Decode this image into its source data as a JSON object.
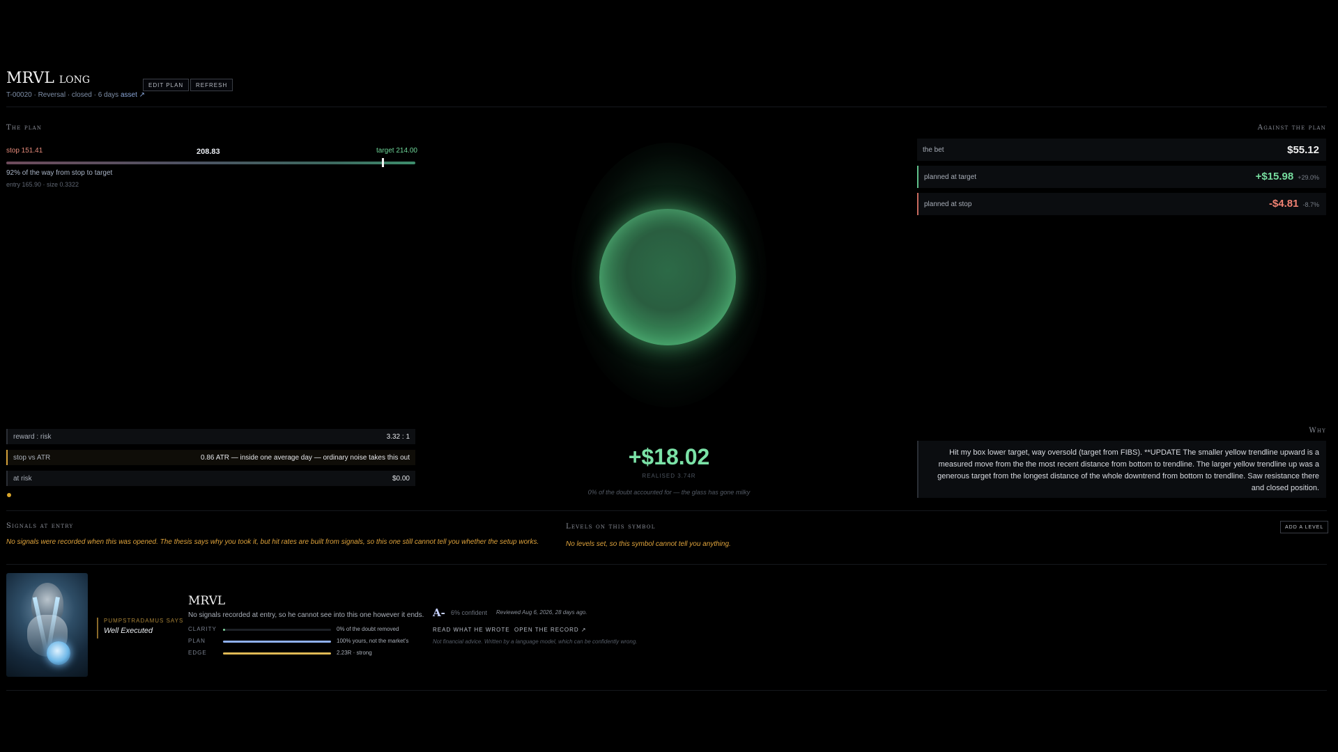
{
  "header": {
    "symbol": "MRVL",
    "direction": "long",
    "subtitle": "T-00020 · Reversal · closed · 6 days",
    "asset_link": "asset ↗",
    "edit_label": "Edit plan",
    "refresh_label": "Refresh"
  },
  "plan": {
    "heading": "The plan",
    "stop_label": "stop 151.41",
    "current_label": "208.83",
    "target_label": "target 214.00",
    "progress_fraction": 0.92,
    "progress_text": "92% of the way from stop to target",
    "entry_text": "entry 165.90 · size 0.3322"
  },
  "metrics": [
    {
      "key": "reward : risk",
      "value": "3.32 : 1"
    },
    {
      "key": "stop vs ATR",
      "value": "0.86 ATR — inside one average day — ordinary noise takes this out"
    },
    {
      "key": "at risk",
      "value": "$0.00"
    }
  ],
  "center": {
    "realised_value": "+$18.02",
    "realised_label": "realised 3.74R",
    "doubt_text": "0% of the doubt accounted for — the glass has gone milky"
  },
  "against": {
    "heading": "Against the plan",
    "bet_label": "the bet",
    "bet_value": "$55.12",
    "target_label": "planned at target",
    "target_value": "+$15.98",
    "target_pct": "+29.0%",
    "stop_label": "planned at stop",
    "stop_value": "-$4.81",
    "stop_pct": "-8.7%"
  },
  "why": {
    "heading": "Why",
    "text": "Hit my box lower target, way oversold (target from FIBS). **UPDATE The smaller yellow trendline upward is a measured move from the the most recent distance from bottom to trendline. The larger yellow trendline up was a generous target from the longest distance of the whole downtrend from bottom to trendline. Saw resistance there and closed position."
  },
  "signals": {
    "heading": "Signals at entry",
    "text": "No signals were recorded when this was opened. The thesis says why you took it, but hit rates are built from signals, so this one still cannot tell you whether the setup works."
  },
  "levels": {
    "heading": "Levels on this symbol",
    "text": "No levels set, so this symbol cannot tell you anything.",
    "add_label": "Add a level"
  },
  "card": {
    "says_label": "Pumpstradamus says",
    "verdict": "Well Executed",
    "title": "MRVL",
    "subtitle": "No signals recorded at entry, so he cannot see into this one however it ends.",
    "meters": [
      {
        "label": "Clarity",
        "fraction": 0.0,
        "note": "0% of the doubt removed",
        "color": "#7fd49b"
      },
      {
        "label": "Plan",
        "fraction": 1.0,
        "note": "100% yours, not the market's",
        "color": "#8fb0f0"
      },
      {
        "label": "Edge",
        "fraction": 1.0,
        "note": "2.23R · strong",
        "color": "#e0b955"
      }
    ],
    "grade": "A-",
    "confidence": "6% confident",
    "reviewed": "Reviewed Aug 6, 2026, 28 days ago.",
    "read_label": "Read what he wrote",
    "record_label": "Open the record ↗",
    "disclaimer": "Not financial advice. Written by a language model, which can be confidently wrong."
  },
  "colors": {
    "green": "#77dd9f",
    "red": "#ef8172",
    "warn": "#e0a43c"
  }
}
